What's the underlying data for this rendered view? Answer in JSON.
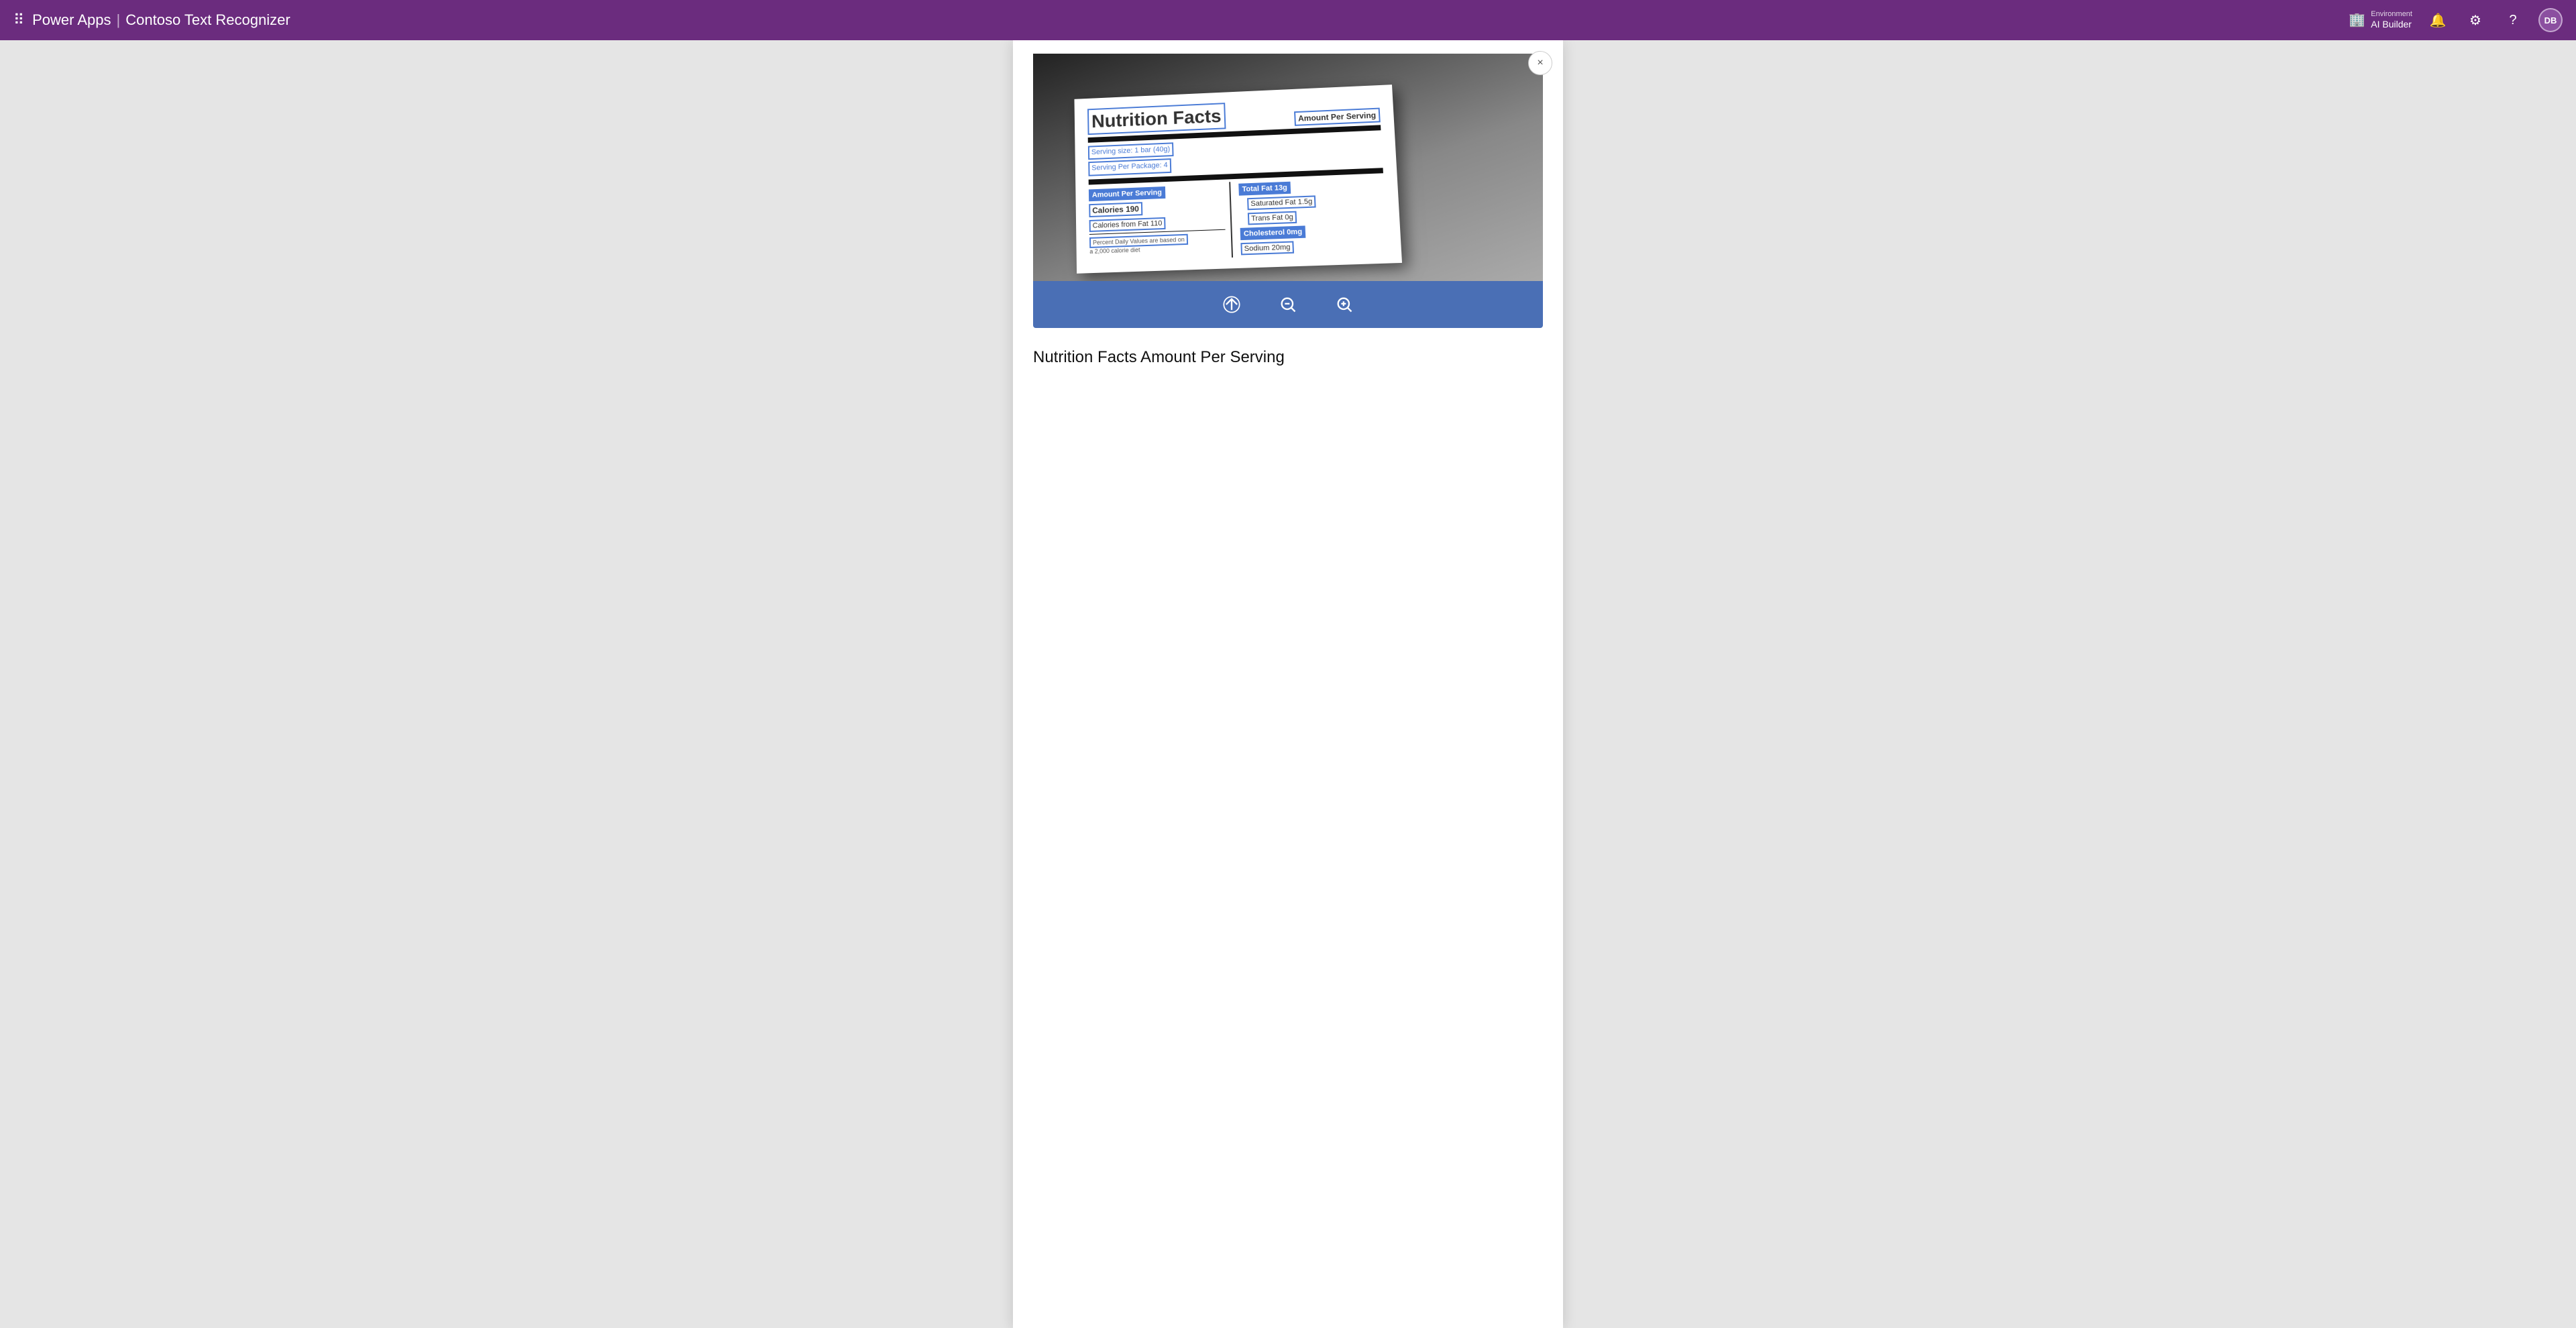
{
  "app": {
    "name": "Power Apps",
    "separator": "|",
    "title": "Contoso Text Recognizer"
  },
  "environment": {
    "label": "Environment",
    "name": "AI Builder"
  },
  "topbar": {
    "icons": {
      "notifications": "🔔",
      "settings": "⚙",
      "help": "?",
      "avatar": "DB"
    }
  },
  "panel": {
    "close_label": "×",
    "image_description": "Nutrition Facts Label",
    "toolbar": {
      "upload_icon": "↑",
      "zoom_out_icon": "−🔍",
      "zoom_in_icon": "+🔍"
    },
    "extracted_text_label": "Nutrition Facts Amount Per Serving"
  },
  "nutrition": {
    "title": "Nutrition Facts",
    "amount_per_serving": "Amount Per Serving",
    "serving_size": "Serving size: 1 bar (40g)",
    "servings_per_package": "Serving Per Package: 4",
    "amount_per_serving2": "Amount Per Serving",
    "calories": "Calories 190",
    "calories_from_fat": "Calories from Fat 110",
    "total_fat": "Total Fat 13g",
    "saturated_fat": "Saturated Fat 1.5g",
    "trans_fat": "Trans Fat 0g",
    "cholesterol": "Cholesterol 0mg",
    "sodium": "Sodium 20mg",
    "footnote": "Percent Daily Values are based on a 2,000 calorie diet"
  }
}
